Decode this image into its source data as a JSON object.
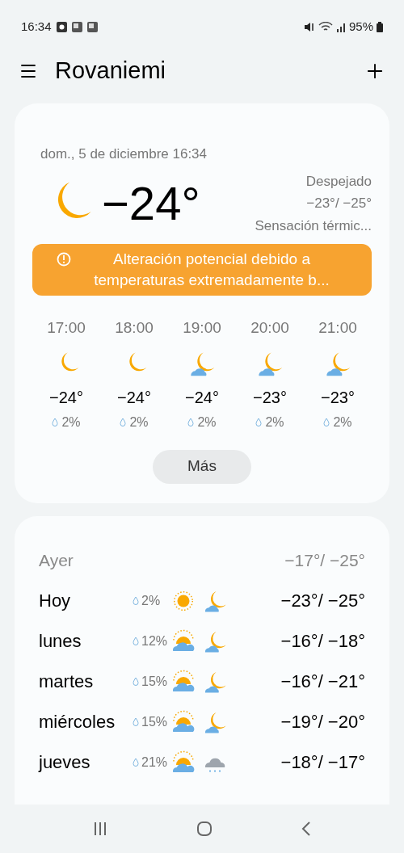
{
  "status_bar": {
    "time": "16:34",
    "battery": "95%"
  },
  "header": {
    "title": "Rovaniemi"
  },
  "current": {
    "date": "dom., 5 de diciembre 16:34",
    "icon": {
      "kind": "moon"
    },
    "temperature": "−24°",
    "condition": "Despejado",
    "range": "−23°/ −25°",
    "feels_like": "Sensación térmic...",
    "alert": "Alteración potencial debido a temperaturas extremadamente b..."
  },
  "hourly": [
    {
      "time": "17:00",
      "icon": {
        "kind": "moon"
      },
      "temp": "−24°",
      "precip": "2%"
    },
    {
      "time": "18:00",
      "icon": {
        "kind": "moon"
      },
      "temp": "−24°",
      "precip": "2%"
    },
    {
      "time": "19:00",
      "icon": {
        "kind": "moon-cloud"
      },
      "temp": "−24°",
      "precip": "2%"
    },
    {
      "time": "20:00",
      "icon": {
        "kind": "moon-cloud"
      },
      "temp": "−23°",
      "precip": "2%"
    },
    {
      "time": "21:00",
      "icon": {
        "kind": "moon-cloud"
      },
      "temp": "−23°",
      "precip": "2%"
    }
  ],
  "more_button": "Más",
  "daily": [
    {
      "kind": "past",
      "day": "Ayer",
      "temps": "−17°/ −25°"
    },
    {
      "kind": "forecast",
      "day": "Hoy",
      "precip": "2%",
      "day_icon": {
        "kind": "sun"
      },
      "night_icon": {
        "kind": "moon-cloud"
      },
      "temps": "−23°/ −25°"
    },
    {
      "kind": "forecast",
      "day": "lunes",
      "precip": "12%",
      "day_icon": {
        "kind": "sun-cloud"
      },
      "night_icon": {
        "kind": "moon-cloud"
      },
      "temps": "−16°/ −18°"
    },
    {
      "kind": "forecast",
      "day": "martes",
      "precip": "15%",
      "day_icon": {
        "kind": "sun-cloud"
      },
      "night_icon": {
        "kind": "moon-cloud"
      },
      "temps": "−16°/ −21°"
    },
    {
      "kind": "forecast",
      "day": "miércoles",
      "precip": "15%",
      "day_icon": {
        "kind": "sun-cloud"
      },
      "night_icon": {
        "kind": "moon-cloud"
      },
      "temps": "−19°/ −20°"
    },
    {
      "kind": "forecast",
      "day": "jueves",
      "precip": "21%",
      "day_icon": {
        "kind": "sun-cloud"
      },
      "night_icon": {
        "kind": "snow-cloud"
      },
      "temps": "−18°/ −17°"
    }
  ]
}
